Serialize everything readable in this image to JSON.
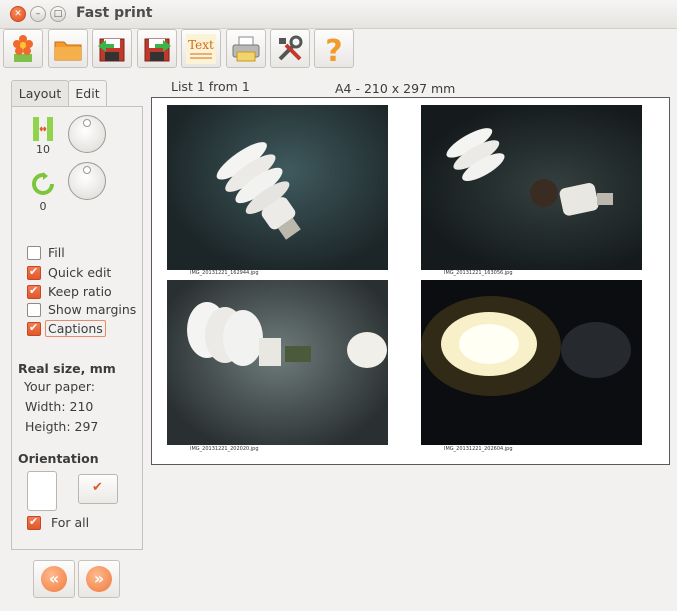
{
  "window": {
    "title": "Fast print"
  },
  "toolbar": [
    {
      "name": "flower-icon"
    },
    {
      "name": "folder-icon"
    },
    {
      "name": "save-icon"
    },
    {
      "name": "save-as-icon"
    },
    {
      "name": "text-icon",
      "label": "Text"
    },
    {
      "name": "printer-icon"
    },
    {
      "name": "settings-icon"
    },
    {
      "name": "help-icon"
    }
  ],
  "tabs": {
    "layout": "Layout",
    "edit": "Edit"
  },
  "edit": {
    "spacing_value": "10",
    "rotation_value": "0",
    "options": {
      "fill": "Fill",
      "quick_edit": "Quick edit",
      "keep_ratio": "Keep ratio",
      "show_margins": "Show margins",
      "captions": "Captions"
    },
    "checked": {
      "fill": false,
      "quick_edit": true,
      "keep_ratio": true,
      "show_margins": false,
      "captions": true
    },
    "real_size": {
      "heading": "Real size, mm",
      "your_paper": "Your paper:",
      "width": "Width: 210",
      "height": "Heigth: 297"
    },
    "orientation": {
      "heading": "Orientation",
      "for_all": "For all"
    }
  },
  "preview": {
    "list_label": "List 1 from 1",
    "paper_label": "A4 - 210 x 297 mm",
    "photos": [
      {
        "caption": "IMG_20131221_162944.jpg"
      },
      {
        "caption": "IMG_20131221_163056.jpg"
      },
      {
        "caption": "IMG_20131221_202020.jpg"
      },
      {
        "caption": "IMG_20131221_202604.jpg"
      }
    ]
  },
  "colors": {
    "accent": "#e2572b",
    "background": "#f2f1f0"
  }
}
